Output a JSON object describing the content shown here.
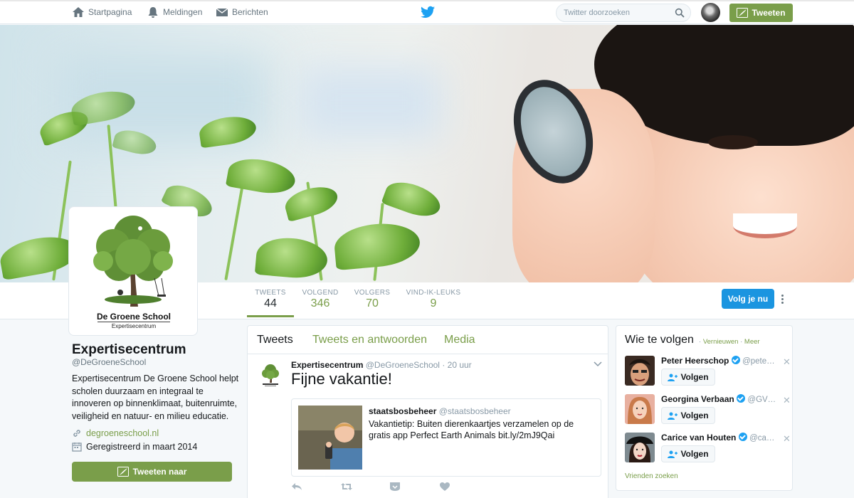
{
  "nav": {
    "home": "Startpagina",
    "notifications": "Meldingen",
    "messages": "Berichten",
    "search_placeholder": "Twitter doorzoeken",
    "tweet_button": "Tweeten"
  },
  "profile": {
    "logo_name": "De Groene School",
    "logo_sub": "Expertisecentrum",
    "name": "Expertisecentrum",
    "handle": "@DeGroeneSchool",
    "bio": "Expertisecentrum De Groene School helpt scholen duurzaam en integraal te innoveren op binnenklimaat, buitenruimte, veiligheid en natuur- en milieu educatie.",
    "website": "degroeneschool.nl",
    "joined": "Geregistreerd in maart 2014",
    "tweet_to_button": "Tweeten naar"
  },
  "stats": [
    {
      "label": "TWEETS",
      "value": "44"
    },
    {
      "label": "VOLGEND",
      "value": "346"
    },
    {
      "label": "VOLGERS",
      "value": "70"
    },
    {
      "label": "VIND-IK-LEUKS",
      "value": "9"
    }
  ],
  "follow_button": "Volg je nu",
  "timeline": {
    "tabs": [
      "Tweets",
      "Tweets en antwoorden",
      "Media"
    ],
    "tweet": {
      "author": "Expertisecentrum",
      "handle": "@DeGroeneSchool",
      "sep": "·",
      "time": "20 uur",
      "text": "Fijne vakantie!",
      "quoted": {
        "author": "staatsbosbeheer",
        "handle": "@staatsbosbeheer",
        "text": "Vakantietip: Buiten dierenkaartjes verzamelen op de gratis app Perfect Earth Animals bit.ly/2mJ9Qai"
      }
    }
  },
  "who_to_follow": {
    "title": "Wie te volgen",
    "sep1": "·",
    "refresh": "Vernieuwen",
    "sep2": "·",
    "more": "Meer",
    "suggestions": [
      {
        "name": "Peter Heerschop",
        "handle": "@pete…",
        "verified": true,
        "button": "Volgen"
      },
      {
        "name": "Georgina Verbaan",
        "handle": "@GV…",
        "verified": true,
        "button": "Volgen"
      },
      {
        "name": "Carice van Houten",
        "handle": "@ca…",
        "verified": true,
        "button": "Volgen"
      }
    ],
    "find_friends": "Vrienden zoeken"
  },
  "colors": {
    "accent": "#7a9e4a",
    "follow_blue": "#1b95e0",
    "twitter_blue": "#1da1f2"
  },
  "icons": [
    "home-icon",
    "bell-icon",
    "envelope-icon",
    "twitter-bird-icon",
    "search-icon",
    "feather-icon",
    "link-icon",
    "calendar-icon",
    "reply-icon",
    "retweet-icon",
    "dm-icon",
    "heart-icon",
    "chevron-down-icon",
    "follow-person-icon",
    "verified-icon"
  ]
}
